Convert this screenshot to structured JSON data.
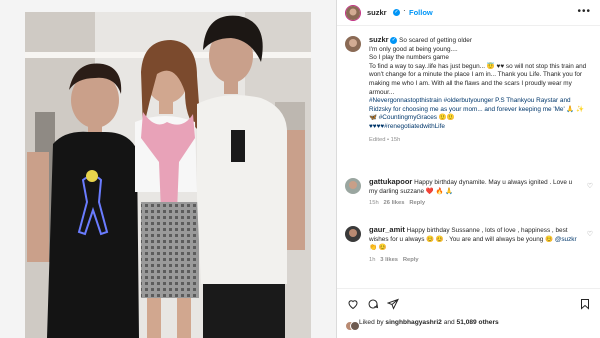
{
  "post": {
    "username": "suzkr",
    "follow_label": "Follow",
    "verified_mark": "✓"
  },
  "caption": {
    "username": "suzkr",
    "lines": [
      "So scared of getting older",
      "I'm only good at being young....",
      "So I play the numbers game",
      "To find a way to say..life has just begun... 😇 ♥♥ so will not stop this train and won't change for a minute the place I am in... Thank you Life. Thank you for making me who I am. With all the flaws and the scars I proudly wear my armour...",
      "#Nevergonnastopthistrain #olderbutyounger P.S Thankyou Raystar and Ridzsky for choosing me as your mom... and forever keeping me 'Me' 🙏 ✨ 🦋 #CountingmyGraces 🙂🙂",
      "♥♥♥♥#renegotiatedwithLife"
    ],
    "meta": "Edited • 15h"
  },
  "comments": [
    {
      "username": "gattukapoor",
      "text": "Happy birthday dynamite. May u always ignited . Love u my darling suzzane ❤️ 🔥 🙏",
      "time": "15h",
      "likes": "26 likes",
      "reply": "Reply"
    },
    {
      "username": "gaur_amit",
      "text": "Happy birthday Sussanne , lots of love , happiness , best wishes for u always 😊 😊 . You are and will always be young 😊",
      "mention": "@suzkr",
      "text_end": "👏 😊",
      "time": "1h",
      "likes": "3 likes",
      "reply": "Reply"
    }
  ],
  "footer": {
    "liked_by_prefix": "Liked by",
    "liked_by_user": "singhbhagyashri2",
    "liked_by_mid": "and",
    "liked_by_count": "51,089 others"
  },
  "icons": {
    "verified": "verified-badge-icon",
    "more": "more-options-icon",
    "heart": "heart-icon",
    "comment": "comment-icon",
    "share": "share-icon",
    "bookmark": "bookmark-icon"
  },
  "colors": {
    "accent": "#0095f6",
    "hashtag": "#00376b",
    "meta": "#8e8e8e",
    "text": "#262626",
    "backdrop": "#262626"
  }
}
